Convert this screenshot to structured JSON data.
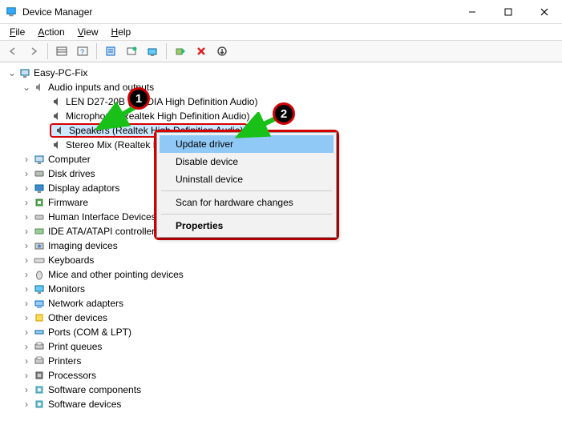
{
  "window": {
    "title": "Device Manager"
  },
  "menu": {
    "file": "File",
    "action": "Action",
    "view": "View",
    "help": "Help"
  },
  "tree": {
    "root": "Easy-PC-Fix",
    "audio_category": "Audio inputs and outputs",
    "audio_items": {
      "len": "LEN D27-20B (NVIDIA High Definition Audio)",
      "mic": "Microphone (Realtek High Definition Audio)",
      "speakers": "Speakers (Realtek High Definition Audio)",
      "stereo": "Stereo Mix (Realtek High Definition Audio)"
    },
    "categories": [
      "Computer",
      "Disk drives",
      "Display adaptors",
      "Firmware",
      "Human Interface Devices",
      "IDE ATA/ATAPI controllers",
      "Imaging devices",
      "Keyboards",
      "Mice and other pointing devices",
      "Monitors",
      "Network adapters",
      "Other devices",
      "Ports (COM & LPT)",
      "Print queues",
      "Printers",
      "Processors",
      "Software components",
      "Software devices"
    ]
  },
  "context_menu": {
    "update": "Update driver",
    "disable": "Disable device",
    "uninstall": "Uninstall device",
    "scan": "Scan for hardware changes",
    "properties": "Properties"
  },
  "badges": {
    "one": "1",
    "two": "2"
  }
}
